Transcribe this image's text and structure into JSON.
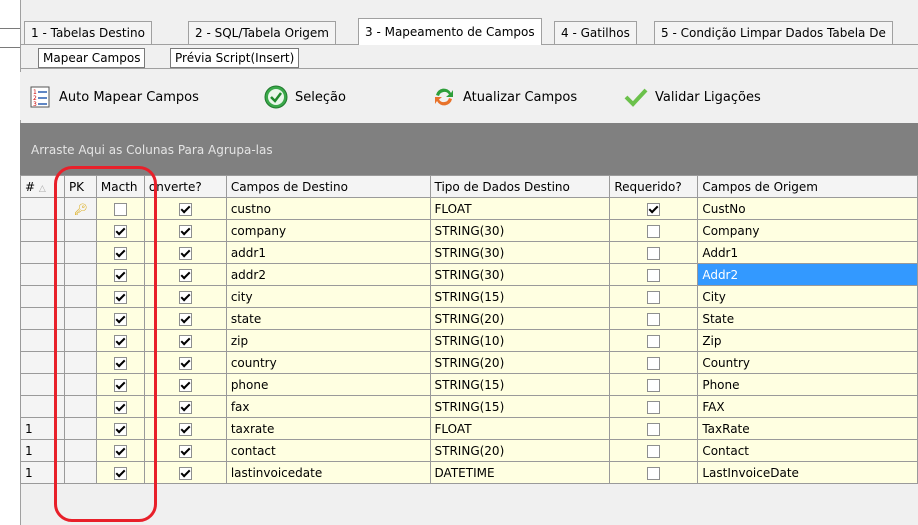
{
  "tabs": [
    {
      "label": "1 - Tabelas Destino",
      "active": false
    },
    {
      "label": "2 - SQL/Tabela Origem",
      "active": false
    },
    {
      "label": "3 - Mapeamento de Campos",
      "active": true
    },
    {
      "label": "4 - Gatilhos",
      "active": false
    },
    {
      "label": "5 - Condição Limpar Dados Tabela De",
      "active": false
    }
  ],
  "subtabs": [
    "Mapear Campos",
    "Prévia Script(Insert)"
  ],
  "toolbar": {
    "auto_map": "Auto Mapear Campos",
    "selection": "Seleção",
    "refresh": "Atualizar Campos",
    "validate": "Validar Ligações"
  },
  "group_panel": "Arraste Aqui as Colunas Para Agrupa-las",
  "grid": {
    "headers": {
      "row": "#",
      "pk": "PK",
      "match": "Macth",
      "convert": "onverte?",
      "dest": "Campos de Destino",
      "type": "Tipo de Dados Destino",
      "required": "Requerido?",
      "origin": "Campos de Origem"
    },
    "rows": [
      {
        "n": "",
        "pk": true,
        "match": false,
        "convert": true,
        "dest": "custno",
        "type": "FLOAT",
        "required": true,
        "origin": "CustNo"
      },
      {
        "n": "",
        "pk": false,
        "match": true,
        "convert": true,
        "dest": "company",
        "type": "STRING(30)",
        "required": false,
        "origin": "Company"
      },
      {
        "n": "",
        "pk": false,
        "match": true,
        "convert": true,
        "dest": "addr1",
        "type": "STRING(30)",
        "required": false,
        "origin": "Addr1"
      },
      {
        "n": "",
        "pk": false,
        "match": true,
        "convert": true,
        "dest": "addr2",
        "type": "STRING(30)",
        "required": false,
        "origin": "Addr2"
      },
      {
        "n": "",
        "pk": false,
        "match": true,
        "convert": true,
        "dest": "city",
        "type": "STRING(15)",
        "required": false,
        "origin": "City"
      },
      {
        "n": "",
        "pk": false,
        "match": true,
        "convert": true,
        "dest": "state",
        "type": "STRING(20)",
        "required": false,
        "origin": "State"
      },
      {
        "n": "",
        "pk": false,
        "match": true,
        "convert": true,
        "dest": "zip",
        "type": "STRING(10)",
        "required": false,
        "origin": "Zip"
      },
      {
        "n": "",
        "pk": false,
        "match": true,
        "convert": true,
        "dest": "country",
        "type": "STRING(20)",
        "required": false,
        "origin": "Country"
      },
      {
        "n": "",
        "pk": false,
        "match": true,
        "convert": true,
        "dest": "phone",
        "type": "STRING(15)",
        "required": false,
        "origin": "Phone"
      },
      {
        "n": "",
        "pk": false,
        "match": true,
        "convert": true,
        "dest": "fax",
        "type": "STRING(15)",
        "required": false,
        "origin": "FAX"
      },
      {
        "n": "1",
        "pk": false,
        "match": true,
        "convert": true,
        "dest": "taxrate",
        "type": "FLOAT",
        "required": false,
        "origin": "TaxRate"
      },
      {
        "n": "1",
        "pk": false,
        "match": true,
        "convert": true,
        "dest": "contact",
        "type": "STRING(20)",
        "required": false,
        "origin": "Contact"
      },
      {
        "n": "1",
        "pk": false,
        "match": true,
        "convert": true,
        "dest": "lastinvoicedate",
        "type": "DATETIME",
        "required": false,
        "origin": "LastInvoiceDate"
      }
    ],
    "selected_row": 3
  },
  "colors": {
    "row_bg": "#ffffe1",
    "selection": "#3399ff",
    "annotation": "#e8202a",
    "group_panel": "#808080"
  }
}
